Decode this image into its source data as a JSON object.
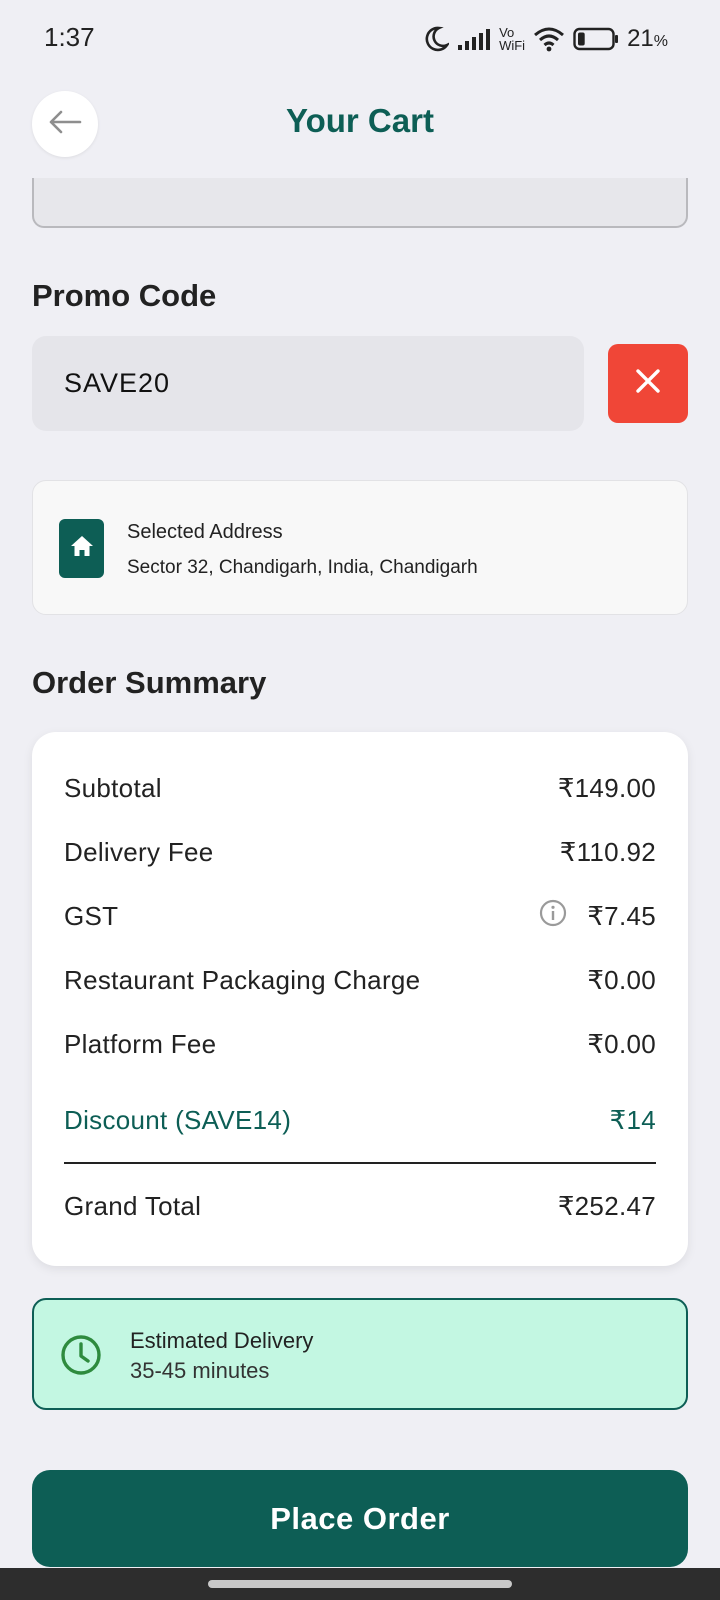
{
  "status_bar": {
    "time": "1:37",
    "network_label_top": "Vo",
    "network_label_bottom": "WiFi",
    "battery_percent": "21",
    "battery_suffix": "%",
    "battery_level": 0.21
  },
  "header": {
    "title": "Your Cart",
    "back_icon": "arrow-left-icon"
  },
  "promo": {
    "heading": "Promo Code",
    "value": "SAVE20",
    "remove_icon": "close-icon",
    "remove_color": "#f04637"
  },
  "address": {
    "title": "Selected Address",
    "text": "Sector 32, Chandigarh, India, Chandigarh",
    "icon": "home-icon"
  },
  "summary": {
    "heading": "Order Summary",
    "rows": [
      {
        "label": "Subtotal",
        "value": "₹149.00"
      },
      {
        "label": "Delivery Fee",
        "value": "₹110.92"
      },
      {
        "label": "GST",
        "value": "₹7.45",
        "info_icon": "info-icon"
      },
      {
        "label": "Restaurant Packaging Charge",
        "value": "₹0.00"
      },
      {
        "label": "Platform Fee",
        "value": "₹0.00"
      }
    ],
    "discount": {
      "label": "Discount (SAVE14)",
      "value": "₹14"
    },
    "grand_total": {
      "label": "Grand Total",
      "value": "₹252.47"
    }
  },
  "delivery": {
    "title": "Estimated Delivery",
    "time": "35-45 minutes",
    "icon": "clock-icon",
    "background": "#c3f7e2"
  },
  "actions": {
    "place_order_label": "Place Order"
  },
  "colors": {
    "brand": "#0d5e55",
    "background": "#efeff4",
    "danger": "#f04637"
  }
}
